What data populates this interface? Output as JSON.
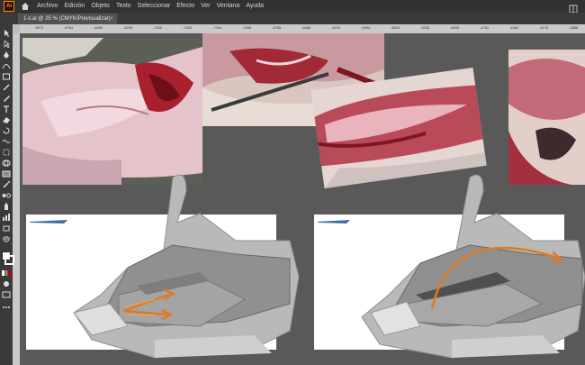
{
  "app": {
    "logo_text": "Ai"
  },
  "menu": [
    "Archivo",
    "Edición",
    "Objeto",
    "Texto",
    "Seleccionar",
    "Efecto",
    "Ver",
    "Ventana",
    "Ayuda"
  ],
  "document_tab": {
    "title": "1-s.ai @ 25 % (CMYK/Previsualizar)",
    "close": "×"
  },
  "ruler_labels": [
    "-9072",
    "-8784",
    "-8496",
    "-8208",
    "-7920",
    "-7632",
    "-7344",
    "-7056",
    "-6768",
    "-6480",
    "-6192",
    "-5904",
    "-5616",
    "-5328",
    "-5040",
    "-4752",
    "-4464",
    "-4176",
    "-3888"
  ],
  "colors": {
    "accent_orange": "#e07a1f",
    "menubar": "#323232",
    "canvas": "#595959"
  }
}
